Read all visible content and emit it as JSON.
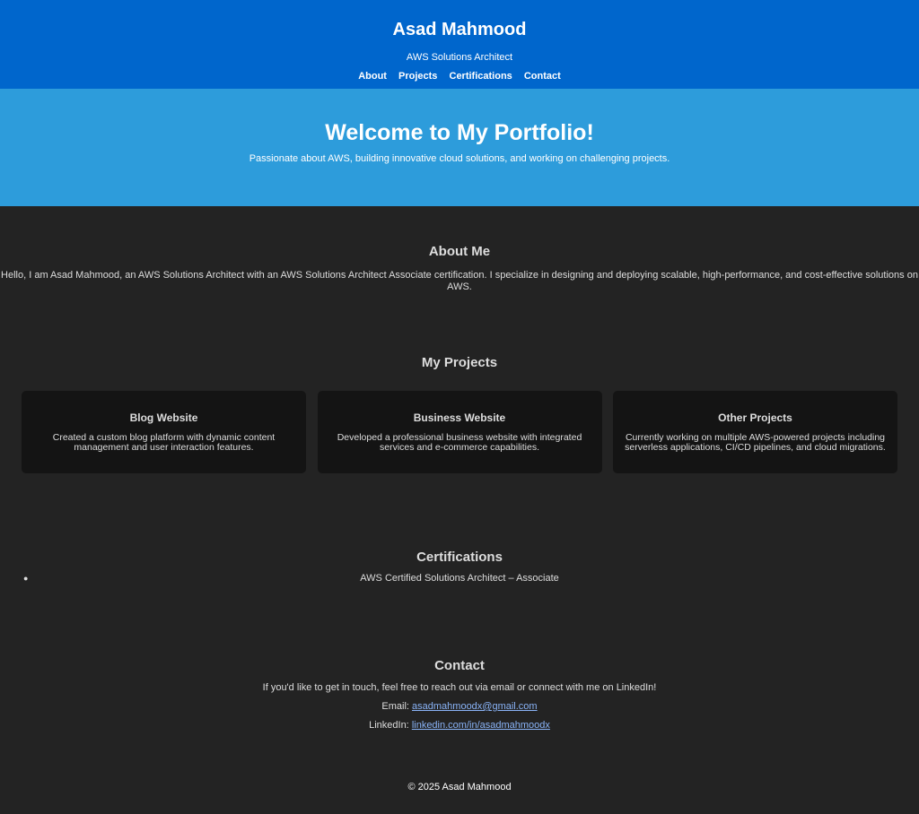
{
  "header": {
    "name": "Asad Mahmood",
    "role": "AWS Solutions Architect",
    "nav": [
      {
        "label": "About"
      },
      {
        "label": "Projects"
      },
      {
        "label": "Certifications"
      },
      {
        "label": "Contact"
      }
    ]
  },
  "hero": {
    "title": "Welcome to My Portfolio!",
    "subtitle": "Passionate about AWS, building innovative cloud solutions, and working on challenging projects."
  },
  "about": {
    "heading": "About Me",
    "text": "Hello, I am Asad Mahmood, an AWS Solutions Architect with an AWS Solutions Architect Associate certification. I specialize in designing and deploying scalable, high-performance, and cost-effective solutions on AWS."
  },
  "projects": {
    "heading": "My Projects",
    "items": [
      {
        "title": "Blog Website",
        "description": "Created a custom blog platform with dynamic content management and user interaction features."
      },
      {
        "title": "Business Website",
        "description": "Developed a professional business website with integrated services and e-commerce capabilities."
      },
      {
        "title": "Other Projects",
        "description": "Currently working on multiple AWS-powered projects including serverless applications, CI/CD pipelines, and cloud migrations."
      }
    ]
  },
  "certifications": {
    "heading": "Certifications",
    "items": [
      {
        "label": "AWS Certified Solutions Architect – Associate"
      }
    ]
  },
  "contact": {
    "heading": "Contact",
    "intro": "If you'd like to get in touch, feel free to reach out via email or connect with me on LinkedIn!",
    "email_label": "Email:",
    "email": "asadmahmoodx@gmail.com",
    "linkedin_label": "LinkedIn:",
    "linkedin": "linkedin.com/in/asadmahmoodx"
  },
  "footer": {
    "text": "© 2025 Asad Mahmood"
  },
  "colors": {
    "header_bg": "#0066cc",
    "hero_bg": "#2d9cdb",
    "page_bg": "#232323",
    "card_bg": "#141414",
    "link": "#8ab4f8"
  }
}
